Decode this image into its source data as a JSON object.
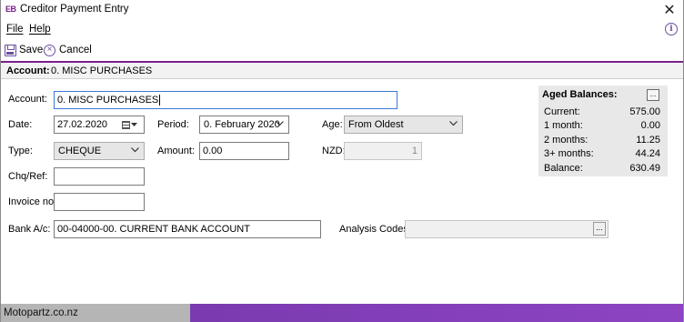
{
  "window": {
    "logo": "EB",
    "title": "Creditor Payment Entry",
    "close_glyph": "✕"
  },
  "menu": {
    "file": "File",
    "help": "Help",
    "info_glyph": "i"
  },
  "toolbar": {
    "save_label": "Save",
    "cancel_label": "Cancel"
  },
  "account_strip": {
    "label": "Account:",
    "value": "0. MISC PURCHASES"
  },
  "form": {
    "account": {
      "label": "Account:",
      "value": "0. MISC PURCHASES"
    },
    "date": {
      "label": "Date:",
      "value": "27.02.2020"
    },
    "period": {
      "label": "Period:",
      "value": "0. February 2020"
    },
    "age": {
      "label": "Age:",
      "value": "From Oldest"
    },
    "type": {
      "label": "Type:",
      "value": "CHEQUE"
    },
    "amount": {
      "label": "Amount:",
      "value": "0.00"
    },
    "nzd": {
      "label": "NZD:",
      "value": "1"
    },
    "chq_ref": {
      "label": "Chq/Ref:",
      "value": ""
    },
    "invoice_no": {
      "label": "Invoice no:",
      "value": ""
    },
    "bank_ac": {
      "label": "Bank A/c:",
      "value": "00-04000-00. CURRENT BANK ACCOUNT"
    },
    "analysis_codes": {
      "label": "Analysis Codes:",
      "value": "",
      "button": "..."
    }
  },
  "aged_balances": {
    "title": "Aged Balances:",
    "menu_button": "...",
    "rows": [
      {
        "label": "Current:",
        "value": "575.00"
      },
      {
        "label": "1 month:",
        "value": "0.00"
      },
      {
        "label": "2 months:",
        "value": "11.25"
      },
      {
        "label": "3+ months:",
        "value": "44.24"
      },
      {
        "label": "Balance:",
        "value": "630.49"
      }
    ]
  },
  "footer": {
    "text": "Motopartz.co.nz"
  },
  "colors": {
    "brand_purple": "#7a1f8e",
    "focus_blue": "#3a79d8",
    "panel_grey": "#e8e8e8"
  }
}
